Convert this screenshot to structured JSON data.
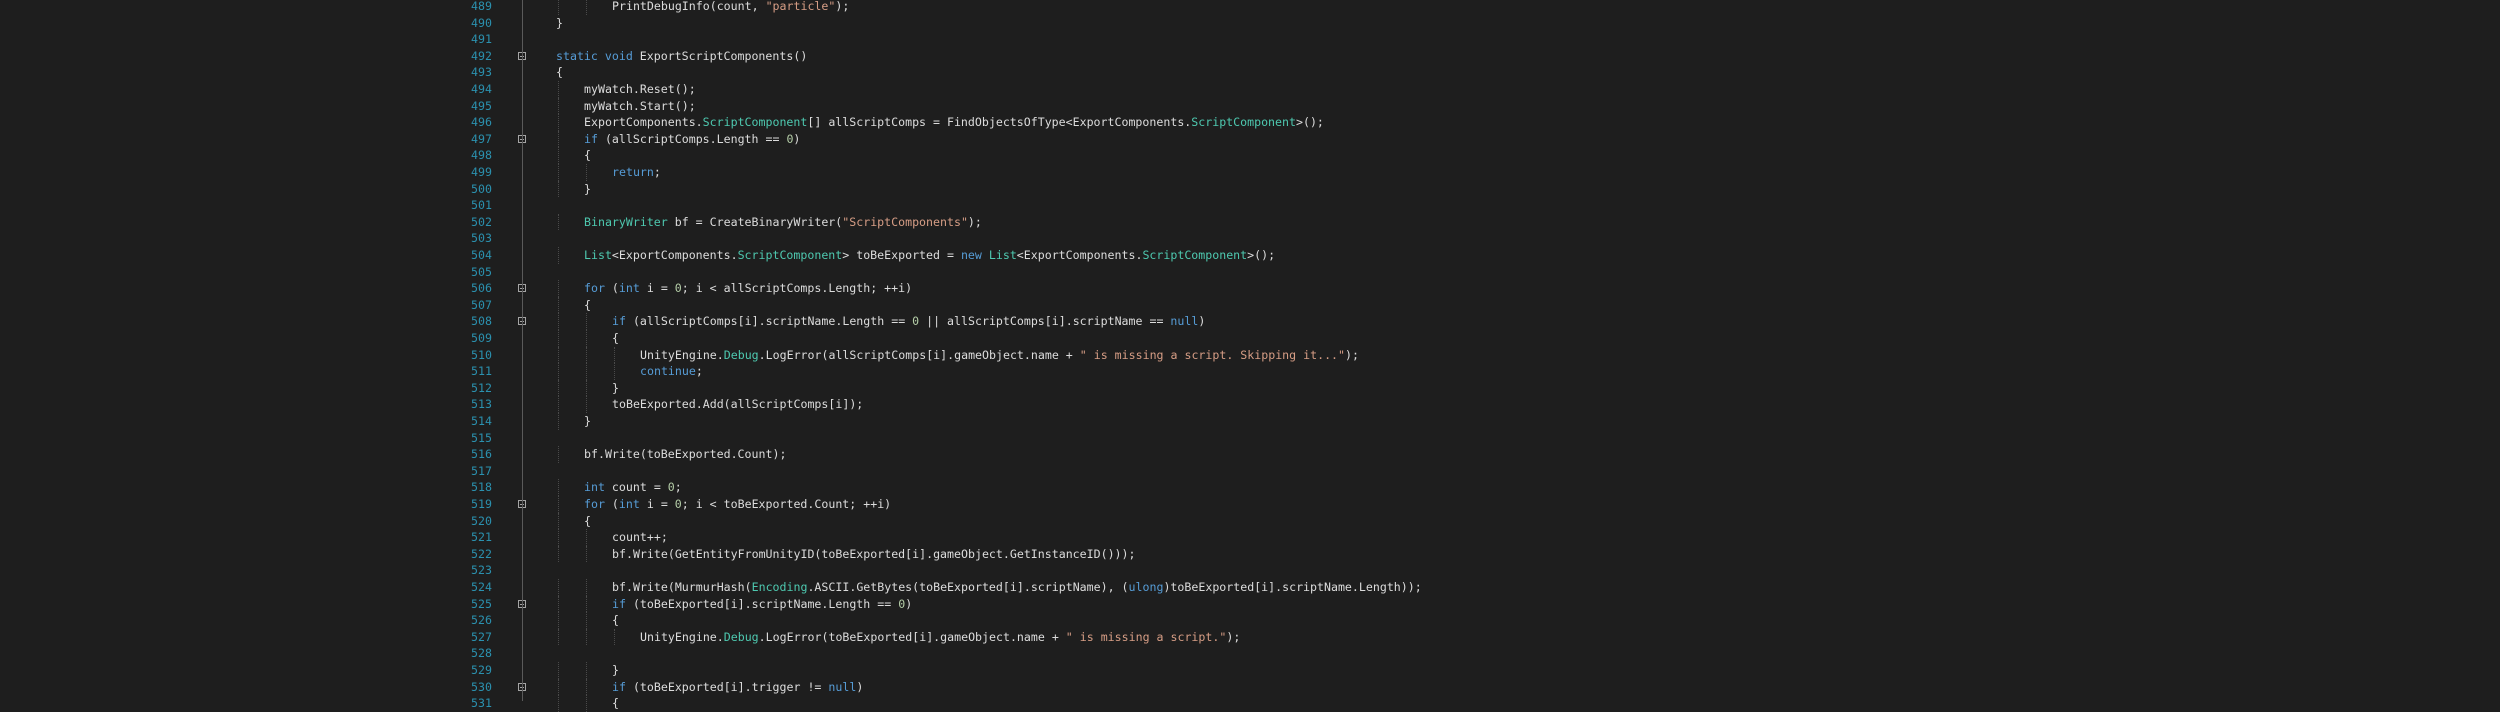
{
  "editor": {
    "colors": {
      "background": "#1e1e1e",
      "line_number": "#2b91af",
      "keyword": "#569cd6",
      "type": "#4ec9b0",
      "string": "#d69d85",
      "number": "#b5cea8",
      "plain": "#dcdcdc"
    },
    "lines": [
      {
        "n": "489",
        "indent": 2,
        "fold": "",
        "tokens": [
          {
            "t": "PrintDebugInfo(count, ",
            "c": "plain"
          },
          {
            "t": "\"particle\"",
            "c": "string"
          },
          {
            "t": ");",
            "c": "plain"
          }
        ]
      },
      {
        "n": "490",
        "indent": 0,
        "fold": "end",
        "tokens": [
          {
            "t": "}",
            "c": "plain"
          }
        ]
      },
      {
        "n": "491",
        "indent": 0,
        "fold": "",
        "tokens": []
      },
      {
        "n": "492",
        "indent": 0,
        "fold": "start",
        "tokens": [
          {
            "t": "static",
            "c": "keyword"
          },
          {
            "t": " ",
            "c": "plain"
          },
          {
            "t": "void",
            "c": "keyword"
          },
          {
            "t": " ExportScriptComponents()",
            "c": "plain"
          }
        ]
      },
      {
        "n": "493",
        "indent": 0,
        "fold": "",
        "tokens": [
          {
            "t": "{",
            "c": "plain"
          }
        ]
      },
      {
        "n": "494",
        "indent": 1,
        "fold": "",
        "tokens": [
          {
            "t": "myWatch.Reset();",
            "c": "plain"
          }
        ]
      },
      {
        "n": "495",
        "indent": 1,
        "fold": "",
        "tokens": [
          {
            "t": "myWatch.Start();",
            "c": "plain"
          }
        ]
      },
      {
        "n": "496",
        "indent": 1,
        "fold": "",
        "tokens": [
          {
            "t": "ExportComponents.",
            "c": "plain"
          },
          {
            "t": "ScriptComponent",
            "c": "type"
          },
          {
            "t": "[] allScriptComps = FindObjectsOfType<ExportComponents.",
            "c": "plain"
          },
          {
            "t": "ScriptComponent",
            "c": "type"
          },
          {
            "t": ">();",
            "c": "plain"
          }
        ]
      },
      {
        "n": "497",
        "indent": 1,
        "fold": "start",
        "tokens": [
          {
            "t": "if",
            "c": "keyword"
          },
          {
            "t": " (allScriptComps.Length == ",
            "c": "plain"
          },
          {
            "t": "0",
            "c": "number"
          },
          {
            "t": ")",
            "c": "plain"
          }
        ]
      },
      {
        "n": "498",
        "indent": 1,
        "fold": "",
        "tokens": [
          {
            "t": "{",
            "c": "plain"
          }
        ]
      },
      {
        "n": "499",
        "indent": 2,
        "fold": "",
        "tokens": [
          {
            "t": "return",
            "c": "keyword"
          },
          {
            "t": ";",
            "c": "plain"
          }
        ]
      },
      {
        "n": "500",
        "indent": 1,
        "fold": "end",
        "tokens": [
          {
            "t": "}",
            "c": "plain"
          }
        ]
      },
      {
        "n": "501",
        "indent": 0,
        "fold": "",
        "tokens": []
      },
      {
        "n": "502",
        "indent": 1,
        "fold": "",
        "tokens": [
          {
            "t": "BinaryWriter",
            "c": "type"
          },
          {
            "t": " bf = CreateBinaryWriter(",
            "c": "plain"
          },
          {
            "t": "\"ScriptComponents\"",
            "c": "string"
          },
          {
            "t": ");",
            "c": "plain"
          }
        ]
      },
      {
        "n": "503",
        "indent": 0,
        "fold": "",
        "tokens": []
      },
      {
        "n": "504",
        "indent": 1,
        "fold": "",
        "tokens": [
          {
            "t": "List",
            "c": "type"
          },
          {
            "t": "<ExportComponents.",
            "c": "plain"
          },
          {
            "t": "ScriptComponent",
            "c": "type"
          },
          {
            "t": "> toBeExported = ",
            "c": "plain"
          },
          {
            "t": "new",
            "c": "keyword"
          },
          {
            "t": " ",
            "c": "plain"
          },
          {
            "t": "List",
            "c": "type"
          },
          {
            "t": "<ExportComponents.",
            "c": "plain"
          },
          {
            "t": "ScriptComponent",
            "c": "type"
          },
          {
            "t": ">();",
            "c": "plain"
          }
        ]
      },
      {
        "n": "505",
        "indent": 0,
        "fold": "",
        "tokens": []
      },
      {
        "n": "506",
        "indent": 1,
        "fold": "start",
        "tokens": [
          {
            "t": "for",
            "c": "keyword"
          },
          {
            "t": " (",
            "c": "plain"
          },
          {
            "t": "int",
            "c": "keyword"
          },
          {
            "t": " i = ",
            "c": "plain"
          },
          {
            "t": "0",
            "c": "number"
          },
          {
            "t": "; i < allScriptComps.Length; ++i)",
            "c": "plain"
          }
        ]
      },
      {
        "n": "507",
        "indent": 1,
        "fold": "",
        "tokens": [
          {
            "t": "{",
            "c": "plain"
          }
        ]
      },
      {
        "n": "508",
        "indent": 2,
        "fold": "start",
        "tokens": [
          {
            "t": "if",
            "c": "keyword"
          },
          {
            "t": " (allScriptComps[i].scriptName.Length == ",
            "c": "plain"
          },
          {
            "t": "0",
            "c": "number"
          },
          {
            "t": " || allScriptComps[i].scriptName == ",
            "c": "plain"
          },
          {
            "t": "null",
            "c": "keyword"
          },
          {
            "t": ")",
            "c": "plain"
          }
        ]
      },
      {
        "n": "509",
        "indent": 2,
        "fold": "",
        "tokens": [
          {
            "t": "{",
            "c": "plain"
          }
        ]
      },
      {
        "n": "510",
        "indent": 3,
        "fold": "",
        "tokens": [
          {
            "t": "UnityEngine.",
            "c": "plain"
          },
          {
            "t": "Debug",
            "c": "type"
          },
          {
            "t": ".LogError(allScriptComps[i].gameObject.name + ",
            "c": "plain"
          },
          {
            "t": "\" is missing a script. Skipping it...\"",
            "c": "string"
          },
          {
            "t": ");",
            "c": "plain"
          }
        ]
      },
      {
        "n": "511",
        "indent": 3,
        "fold": "",
        "tokens": [
          {
            "t": "continue",
            "c": "keyword"
          },
          {
            "t": ";",
            "c": "plain"
          }
        ]
      },
      {
        "n": "512",
        "indent": 2,
        "fold": "end",
        "tokens": [
          {
            "t": "}",
            "c": "plain"
          }
        ]
      },
      {
        "n": "513",
        "indent": 2,
        "fold": "",
        "tokens": [
          {
            "t": "toBeExported.Add(allScriptComps[i]);",
            "c": "plain"
          }
        ]
      },
      {
        "n": "514",
        "indent": 1,
        "fold": "end",
        "tokens": [
          {
            "t": "}",
            "c": "plain"
          }
        ]
      },
      {
        "n": "515",
        "indent": 0,
        "fold": "",
        "tokens": []
      },
      {
        "n": "516",
        "indent": 1,
        "fold": "",
        "tokens": [
          {
            "t": "bf.Write(toBeExported.Count);",
            "c": "plain"
          }
        ]
      },
      {
        "n": "517",
        "indent": 0,
        "fold": "",
        "tokens": []
      },
      {
        "n": "518",
        "indent": 1,
        "fold": "",
        "tokens": [
          {
            "t": "int",
            "c": "keyword"
          },
          {
            "t": " count = ",
            "c": "plain"
          },
          {
            "t": "0",
            "c": "number"
          },
          {
            "t": ";",
            "c": "plain"
          }
        ]
      },
      {
        "n": "519",
        "indent": 1,
        "fold": "start",
        "tokens": [
          {
            "t": "for",
            "c": "keyword"
          },
          {
            "t": " (",
            "c": "plain"
          },
          {
            "t": "int",
            "c": "keyword"
          },
          {
            "t": " i = ",
            "c": "plain"
          },
          {
            "t": "0",
            "c": "number"
          },
          {
            "t": "; i < toBeExported.Count; ++i)",
            "c": "plain"
          }
        ]
      },
      {
        "n": "520",
        "indent": 1,
        "fold": "",
        "tokens": [
          {
            "t": "{",
            "c": "plain"
          }
        ]
      },
      {
        "n": "521",
        "indent": 2,
        "fold": "",
        "tokens": [
          {
            "t": "count++;",
            "c": "plain"
          }
        ]
      },
      {
        "n": "522",
        "indent": 2,
        "fold": "",
        "tokens": [
          {
            "t": "bf.Write(GetEntityFromUnityID(toBeExported[i].gameObject.GetInstanceID()));",
            "c": "plain"
          }
        ]
      },
      {
        "n": "523",
        "indent": 0,
        "fold": "",
        "tokens": []
      },
      {
        "n": "524",
        "indent": 2,
        "fold": "",
        "tokens": [
          {
            "t": "bf.Write(MurmurHash(",
            "c": "plain"
          },
          {
            "t": "Encoding",
            "c": "type"
          },
          {
            "t": ".ASCII.GetBytes(toBeExported[i].scriptName), (",
            "c": "plain"
          },
          {
            "t": "ulong",
            "c": "keyword"
          },
          {
            "t": ")toBeExported[i].scriptName.Length));",
            "c": "plain"
          }
        ]
      },
      {
        "n": "525",
        "indent": 2,
        "fold": "start",
        "tokens": [
          {
            "t": "if",
            "c": "keyword"
          },
          {
            "t": " (toBeExported[i].scriptName.Length == ",
            "c": "plain"
          },
          {
            "t": "0",
            "c": "number"
          },
          {
            "t": ")",
            "c": "plain"
          }
        ]
      },
      {
        "n": "526",
        "indent": 2,
        "fold": "",
        "tokens": [
          {
            "t": "{",
            "c": "plain"
          }
        ]
      },
      {
        "n": "527",
        "indent": 3,
        "fold": "",
        "tokens": [
          {
            "t": "UnityEngine.",
            "c": "plain"
          },
          {
            "t": "Debug",
            "c": "type"
          },
          {
            "t": ".LogError(toBeExported[i].gameObject.name + ",
            "c": "plain"
          },
          {
            "t": "\" is missing a script.\"",
            "c": "string"
          },
          {
            "t": ");",
            "c": "plain"
          }
        ]
      },
      {
        "n": "528",
        "indent": 0,
        "fold": "",
        "tokens": []
      },
      {
        "n": "529",
        "indent": 2,
        "fold": "end",
        "tokens": [
          {
            "t": "}",
            "c": "plain"
          }
        ]
      },
      {
        "n": "530",
        "indent": 2,
        "fold": "start",
        "tokens": [
          {
            "t": "if",
            "c": "keyword"
          },
          {
            "t": " (toBeExported[i].trigger != ",
            "c": "plain"
          },
          {
            "t": "null",
            "c": "keyword"
          },
          {
            "t": ")",
            "c": "plain"
          }
        ]
      },
      {
        "n": "531",
        "indent": 2,
        "fold": "",
        "tokens": [
          {
            "t": "{",
            "c": "plain"
          }
        ]
      }
    ]
  }
}
